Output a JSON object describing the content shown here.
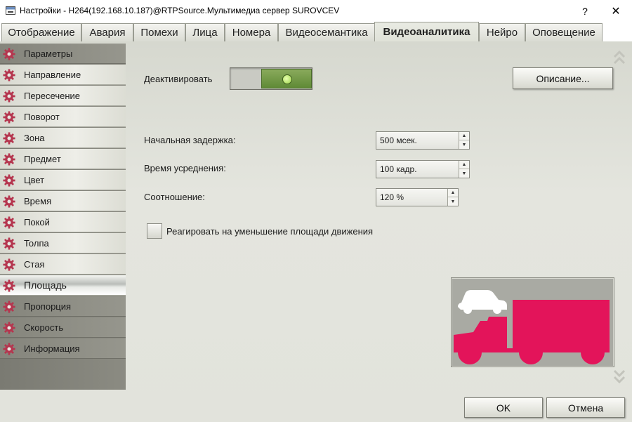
{
  "window": {
    "title": "Настройки - H264(192.168.10.187)@RTPSource.Мультимедиа сервер SUROVCEV",
    "help_label": "?",
    "close_label": "✕"
  },
  "tabs": [
    {
      "label": "Отображение"
    },
    {
      "label": "Авария"
    },
    {
      "label": "Помехи"
    },
    {
      "label": "Лица"
    },
    {
      "label": "Номера"
    },
    {
      "label": "Видеосемантика"
    },
    {
      "label": "Видеоаналитика",
      "active": true
    },
    {
      "label": "Нейро"
    },
    {
      "label": "Оповещение"
    }
  ],
  "sidebar": {
    "items": [
      {
        "label": "Параметры"
      },
      {
        "label": "Направление"
      },
      {
        "label": "Пересечение"
      },
      {
        "label": "Поворот"
      },
      {
        "label": "Зона"
      },
      {
        "label": "Предмет"
      },
      {
        "label": "Цвет"
      },
      {
        "label": "Время"
      },
      {
        "label": "Покой"
      },
      {
        "label": "Толпа"
      },
      {
        "label": "Стая"
      },
      {
        "label": "Площадь",
        "active": true
      },
      {
        "label": "Пропорция"
      },
      {
        "label": "Скорость"
      },
      {
        "label": "Информация"
      }
    ]
  },
  "form": {
    "deactivate_label": "Деактивировать",
    "deactivate_toggle_on": true,
    "description_button": "Описание...",
    "initial_delay_label": "Начальная задержка:",
    "initial_delay_value": "500 мсек.",
    "averaging_time_label": "Время усреднения:",
    "averaging_time_value": "100 кадр.",
    "ratio_label": "Соотношение:",
    "ratio_value": "120 %",
    "react_checkbox_label": "Реагировать на уменьшение площади движения",
    "react_checkbox_checked": false
  },
  "footer": {
    "ok_label": "OK",
    "cancel_label": "Отмена"
  },
  "colors": {
    "accent_pink": "#e3145a",
    "toggle_green": "#6b9440",
    "gear_color": "#b5364f"
  },
  "icons": {
    "sidebar_item_icon": "gear-icon",
    "scroll_up": "double-chevron-up-icon",
    "scroll_down": "double-chevron-down-icon",
    "preview": "car-truck-illustration"
  }
}
